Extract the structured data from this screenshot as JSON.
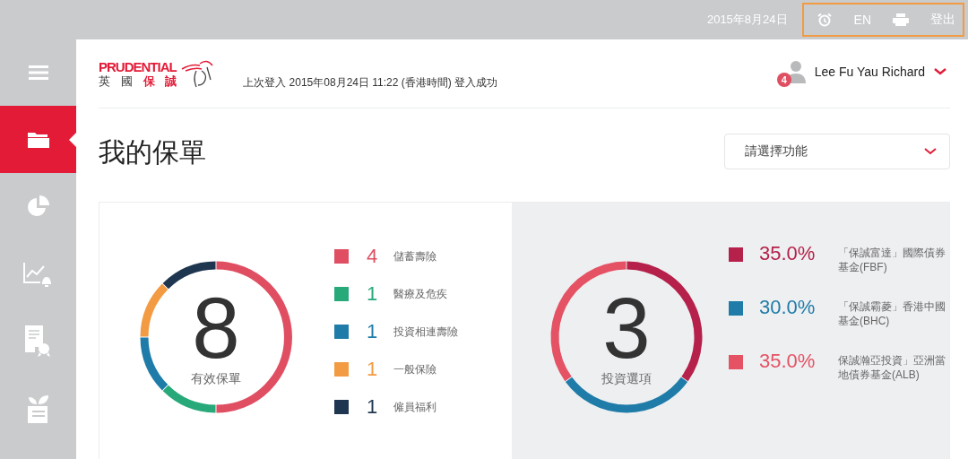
{
  "top_bar": {
    "date": "2015年8月24日",
    "language": "EN",
    "logout": "登出"
  },
  "sidebar": {
    "items": [
      {
        "kind": "menu",
        "selected": false
      },
      {
        "kind": "folder",
        "selected": true
      },
      {
        "kind": "pie",
        "selected": false
      },
      {
        "kind": "chart-bell",
        "selected": false
      },
      {
        "kind": "certificate",
        "selected": false
      },
      {
        "kind": "plant",
        "selected": false
      }
    ]
  },
  "header": {
    "logo": {
      "brand": "PRUDENTIAL",
      "chinese_plain": "英 國",
      "chinese_red": "保 誠"
    },
    "last_login": "上次登入 2015年08月24日 11:22 (香港時間) 登入成功",
    "user_name": "Lee Fu Yau Richard",
    "notification_count": "4"
  },
  "page_title": "我的保單",
  "function_select": {
    "placeholder": "請選擇功能"
  },
  "policies": {
    "total": "8",
    "caption": "有效保單",
    "items": [
      {
        "count": "4",
        "label": "儲蓄壽險",
        "color": "#e04e62"
      },
      {
        "count": "1",
        "label": "醫療及危疾",
        "color": "#27a97a"
      },
      {
        "count": "1",
        "label": "投資相連壽險",
        "color": "#1f7ca8"
      },
      {
        "count": "1",
        "label": "一般保險",
        "color": "#f29b42"
      },
      {
        "count": "1",
        "label": "僱員福利",
        "color": "#1f3650"
      }
    ]
  },
  "investments": {
    "total": "3",
    "caption": "投資選項",
    "items": [
      {
        "percent": "35.0%",
        "label": "「保誠富達」國際債券基金(FBF)",
        "color": "#b5214a"
      },
      {
        "percent": "30.0%",
        "label": "「保誠霸菱」香港中國基金(BHC)",
        "color": "#1f7ca8"
      },
      {
        "percent": "35.0%",
        "label": "保誠瀚亞投資」亞洲當地債券基金(ALB)",
        "color": "#e45264"
      }
    ]
  }
}
